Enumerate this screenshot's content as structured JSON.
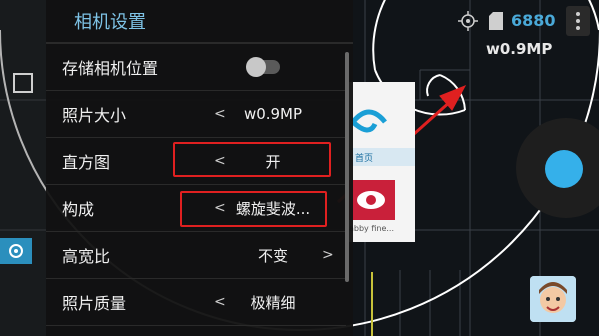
{
  "panel": {
    "title": "相机设置",
    "rows": [
      {
        "label": "存储相机位置",
        "type": "toggle",
        "value": ""
      },
      {
        "label": "照片大小",
        "type": "value",
        "value": "w0.9MP",
        "left_arrow": "<",
        "right_arrow": ""
      },
      {
        "label": "直方图",
        "type": "value",
        "value": "开",
        "left_arrow": "<",
        "right_arrow": ""
      },
      {
        "label": "构成",
        "type": "value",
        "value": "螺旋斐波...",
        "left_arrow": "<",
        "right_arrow": ""
      },
      {
        "label": "高宽比",
        "type": "value",
        "value": "不变",
        "left_arrow": "",
        "right_arrow": ">"
      },
      {
        "label": "照片质量",
        "type": "value",
        "value": "极精细",
        "left_arrow": "<",
        "right_arrow": ""
      }
    ]
  },
  "hud": {
    "counter": "6880",
    "resolution": "w0.9MP"
  },
  "preview_fragment": {
    "tab_label": "首页",
    "caption": "abby fine..."
  },
  "colors": {
    "accent": "#35b0ea",
    "title": "#7ec3e6",
    "highlight": "#e02020",
    "active_mode": "#2b8fbd"
  },
  "icons": {
    "mode_square": "square-icon",
    "mode_active": "camera-ring-icon",
    "target": "crosshair-icon",
    "storage": "sd-card-icon",
    "menu": "more-vert-icon",
    "shutter": "shutter-icon"
  }
}
